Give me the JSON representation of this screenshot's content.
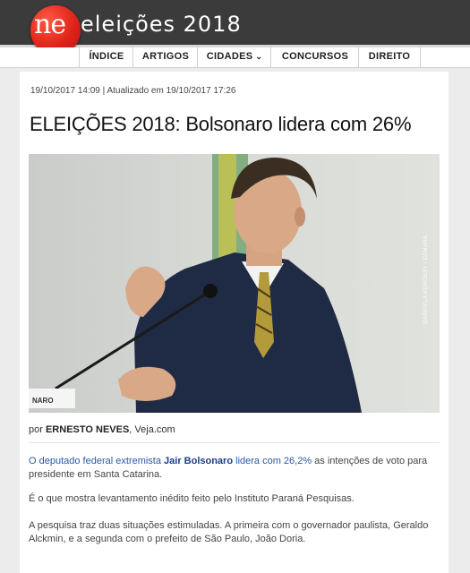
{
  "header": {
    "logo_text": "ne",
    "site_title": "eleições 2018"
  },
  "nav": {
    "items": [
      {
        "label": "ÍNDICE"
      },
      {
        "label": "ARTIGOS"
      },
      {
        "label": "CIDADES",
        "chevron": "chevron-down-icon"
      },
      {
        "label": "CONCURSOS"
      },
      {
        "label": "DIREITO"
      }
    ]
  },
  "article": {
    "meta": "19/10/2017 14:09 | Atualizado em 19/10/2017 17:26",
    "headline": "ELEIÇÕES 2018: Bolsonaro lidera com 26%",
    "photo_credit": "GABRIELA KOROSSY / CÂMARA",
    "byline_prefix": "por",
    "author": "ERNESTO NEVES",
    "source": ", Veja.com",
    "p1_part1": "O deputado federal extremista ",
    "p1_name": "Jair Bolsonaro",
    "p1_part2": " lidera com 26,2%",
    "p1_part3": " as intenções de voto para presidente em Santa Catarina.",
    "p2": "É o que mostra levantamento inédito feito pelo Instituto Paraná Pesquisas.",
    "p3": "A pesquisa traz duas situações estimuladas. A primeira com o governador paulista, Geraldo Alckmin, e a segunda com o prefeito de São Paulo, João Doria."
  },
  "colors": {
    "header_bg": "#3b3b3b",
    "logo_red": "#e0231a",
    "link_blue": "#2a59a8"
  }
}
